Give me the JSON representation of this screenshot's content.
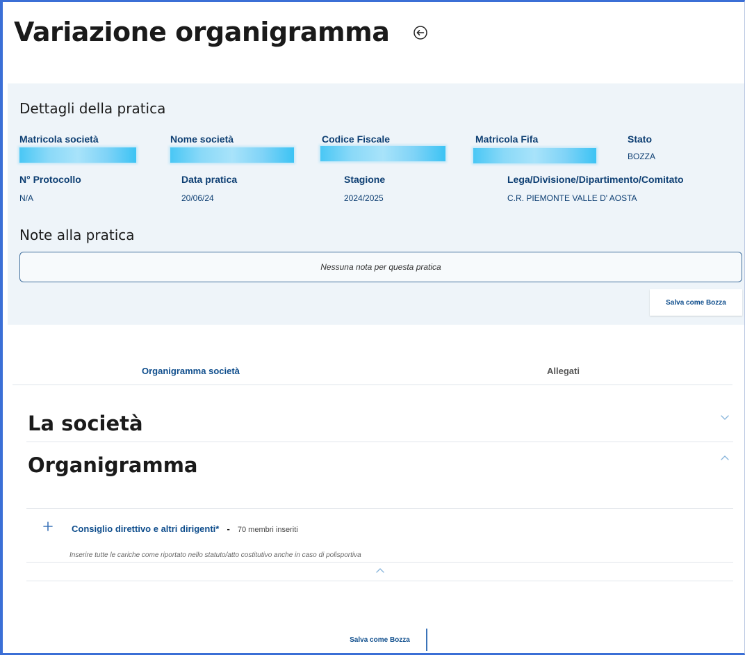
{
  "page": {
    "title": "Variazione organigramma"
  },
  "details": {
    "heading": "Dettagli della pratica",
    "fields_row1": [
      {
        "label": "Matricola società",
        "value": ""
      },
      {
        "label": "Nome società",
        "value": ""
      },
      {
        "label": "Codice Fiscale",
        "value": ""
      },
      {
        "label": "Matricola Fifa",
        "value": ""
      },
      {
        "label": "Stato",
        "value": "BOZZA"
      }
    ],
    "fields_row2": [
      {
        "label": "N° Protocollo",
        "value": "N/A"
      },
      {
        "label": "Data pratica",
        "value": "20/06/24"
      },
      {
        "label": "Stagione",
        "value": "2024/2025"
      },
      {
        "label": "Lega/Divisione/Dipartimento/Comitato",
        "value": "C.R. PIEMONTE VALLE D' AOSTA"
      }
    ]
  },
  "notes": {
    "heading": "Note alla pratica",
    "empty_text": "Nessuna nota per questa pratica",
    "save_label": "Salva come Bozza"
  },
  "tabs": [
    {
      "label": "Organigramma società",
      "active": true
    },
    {
      "label": "Allegati",
      "active": false
    }
  ],
  "sections": {
    "societa": {
      "title": "La società",
      "expanded": false
    },
    "organigramma": {
      "title": "Organigramma",
      "expanded": true,
      "group": {
        "label": "Consiglio direttivo e altri dirigenti*",
        "separator": "-",
        "count_text": "70 membri inseriti",
        "hint": "Inserire tutte le cariche come riportato nello statuto/atto costitutivo anche in caso di polisportiva"
      }
    }
  },
  "footer": {
    "save_label": "Salva come Bozza"
  },
  "colors": {
    "accent": "#0e4d8c",
    "panel_bg": "#eef4f9",
    "frame": "#3b6fd6"
  }
}
